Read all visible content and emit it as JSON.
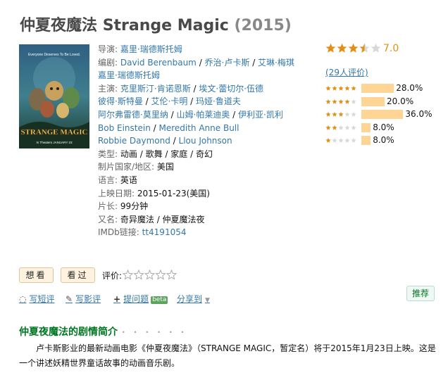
{
  "movie": {
    "title_cn": "仲夏夜魔法",
    "title_en": "Strange Magic",
    "year": "(2015)"
  },
  "poster": {
    "tagline": "Everyone Deserves To Be Loved.",
    "logo_text": "STRANGE MAGIC",
    "release_note": "In Theaters JANUARY 23"
  },
  "info": {
    "director_label": "导演:",
    "director": "嘉里·瑞德斯托姆",
    "writer_label": "编剧:",
    "writers": [
      "David Berenbaum",
      "乔治·卢卡斯",
      "艾琳·梅琪",
      "嘉里·瑞德斯托姆"
    ],
    "cast_label": "主演:",
    "cast": [
      "克里斯汀·肯诺恩斯",
      "埃文·蕾切尔·伍德",
      "彼得·斯特曼",
      "艾伦·卡明",
      "玛娅·鲁道夫",
      "阿尔弗雷德·莫里纳",
      "山姆·帕莱迪奥",
      "伊利亚·凯利",
      "Bob Einstein",
      "Meredith Anne Bull",
      "Robbie Daymond",
      "Llou Johnson"
    ],
    "genre_label": "类型:",
    "genres": [
      "动画",
      "歌舞",
      "家庭",
      "奇幻"
    ],
    "country_label": "制片国家/地区:",
    "country": "美国",
    "language_label": "语言:",
    "language": "英语",
    "release_label": "上映日期:",
    "release": "2015-01-23(美国)",
    "runtime_label": "片长:",
    "runtime": "99分钟",
    "aka_label": "又名:",
    "aka": "奇异魔法 / 仲夏魔法夜",
    "imdb_label": "IMDb链接:",
    "imdb": "tt4191054"
  },
  "rating": {
    "score": "7.0",
    "score_value": 7.0,
    "votes": "(29人评价)",
    "distribution": [
      {
        "stars": 5,
        "percent": "28.0%",
        "value": 28.0
      },
      {
        "stars": 4,
        "percent": "20.0%",
        "value": 20.0
      },
      {
        "stars": 3,
        "percent": "36.0%",
        "value": 36.0
      },
      {
        "stars": 2,
        "percent": "8.0%",
        "value": 8.0
      },
      {
        "stars": 1,
        "percent": "8.0%",
        "value": 8.0
      }
    ]
  },
  "actions": {
    "want_label": "想看",
    "seen_label": "看过",
    "rate_label": "评价:",
    "short_review": "写短评",
    "review": "写影评",
    "question": "提问题",
    "beta": "beta",
    "share": "分享到",
    "recommend": "推荐"
  },
  "summary": {
    "heading": "仲夏夜魔法的剧情简介",
    "dots": "· · · · · ·",
    "text": "卢卡斯影业的最新动画电影《仲夏夜魔法》（STRANGE MAGIC，暂定名）将于2015年1月23日上映。这是一个讲述妖精世界童话故事的动画音乐剧。"
  },
  "colors": {
    "link": "#3377aa",
    "star": "#e09015",
    "bar": "#ffd596",
    "green": "#007722"
  }
}
